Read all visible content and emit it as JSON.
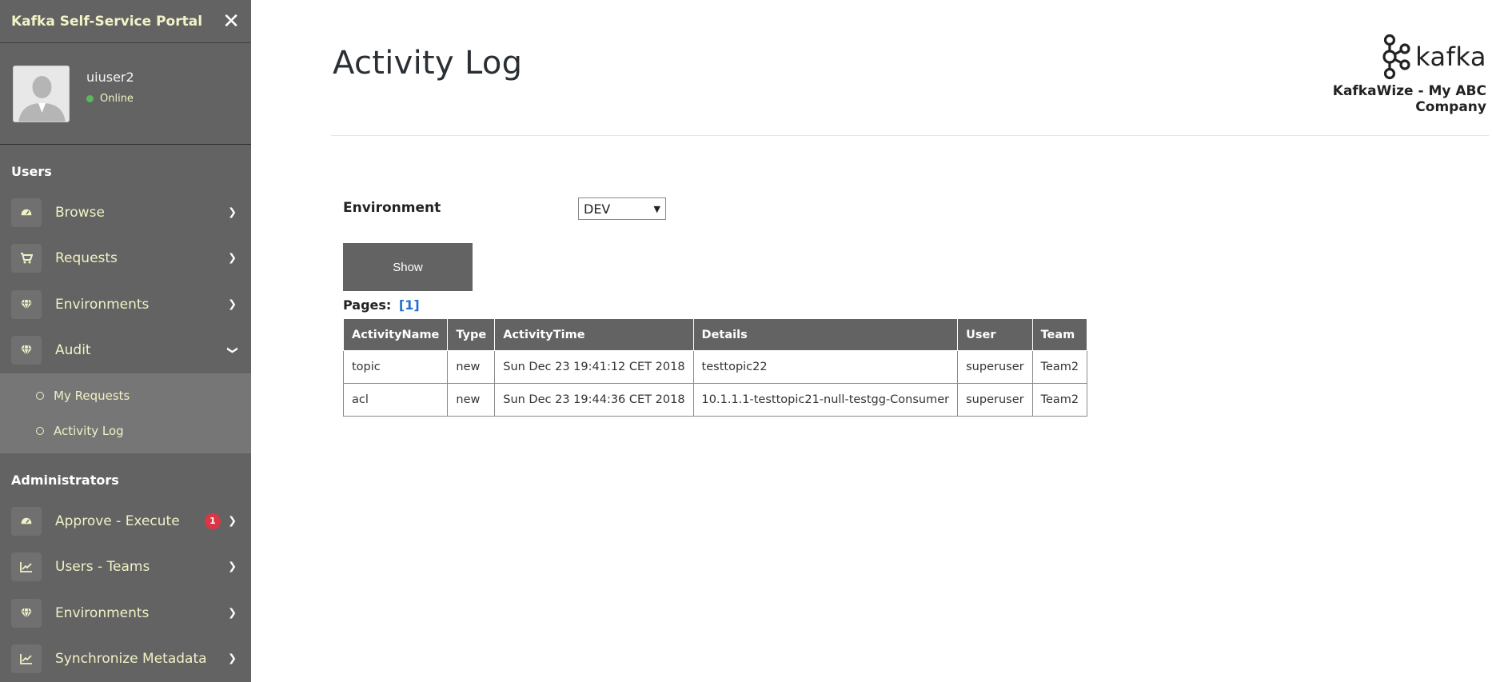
{
  "sidebar": {
    "title": "Kafka Self-Service Portal",
    "close_icon": "close-icon",
    "profile": {
      "username": "uiuser2",
      "status": "Online",
      "status_color": "#5cb85c"
    },
    "sections": {
      "users_label": "Users",
      "admins_label": "Administrators"
    },
    "user_items": [
      {
        "label": "Browse",
        "icon": "dashboard-icon"
      },
      {
        "label": "Requests",
        "icon": "cart-icon"
      },
      {
        "label": "Environments",
        "icon": "diamond-icon"
      },
      {
        "label": "Audit",
        "icon": "diamond-icon"
      }
    ],
    "audit_subitems": [
      {
        "label": "My Requests"
      },
      {
        "label": "Activity Log"
      }
    ],
    "admin_items": [
      {
        "label": "Approve - Execute",
        "icon": "dashboard-icon",
        "badge": "1"
      },
      {
        "label": "Users - Teams",
        "icon": "chart-icon"
      },
      {
        "label": "Environments",
        "icon": "diamond-icon"
      },
      {
        "label": "Synchronize Metadata",
        "icon": "chart-icon"
      }
    ]
  },
  "main": {
    "page_title": "Activity Log",
    "brand": {
      "logo_text": "kafka",
      "company": "KafkaWize - My ABC Company"
    },
    "filter": {
      "environment_label": "Environment",
      "environment_value": "DEV",
      "show_button": "Show"
    },
    "pagination": {
      "label": "Pages:",
      "pages": "[1]"
    },
    "table": {
      "headers": [
        "ActivityName",
        "Type",
        "ActivityTime",
        "Details",
        "User",
        "Team"
      ],
      "rows": [
        [
          "topic",
          "new",
          "Sun Dec 23 19:41:12 CET 2018",
          "testtopic22",
          "superuser",
          "Team2"
        ],
        [
          "acl",
          "new",
          "Sun Dec 23 19:44:36 CET 2018",
          "10.1.1.1-testtopic21-null-testgg-Consumer",
          "superuser",
          "Team2"
        ]
      ]
    }
  },
  "colors": {
    "sidebar_bg": "#636363",
    "sidebar_text": "#f1f1c6",
    "header_bg": "#636363",
    "link": "#1f6fd0",
    "badge": "#dc3545"
  }
}
